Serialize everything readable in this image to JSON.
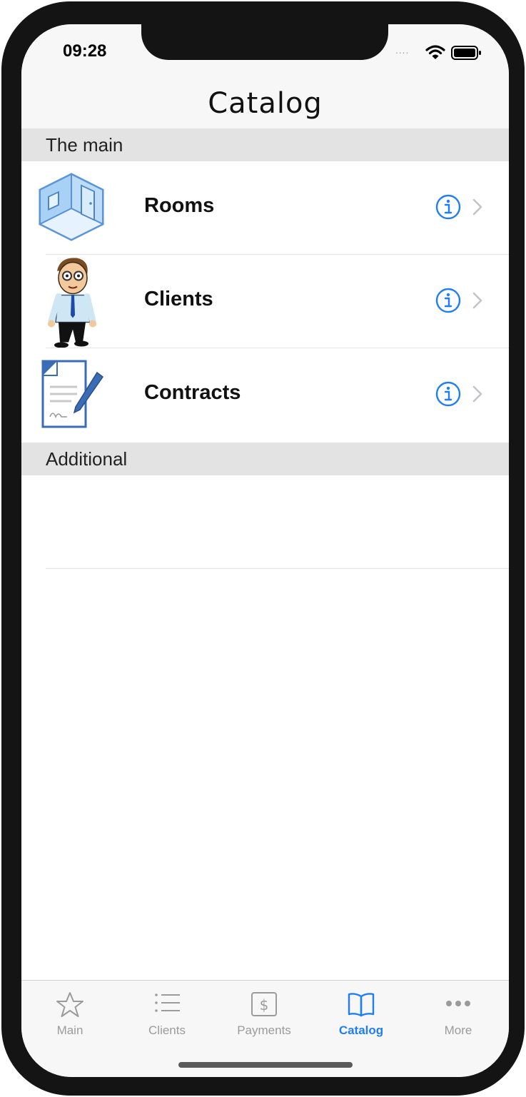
{
  "status_bar": {
    "time": "09:28",
    "signal": "....",
    "wifi_icon": "wifi-icon",
    "battery_icon": "battery-icon"
  },
  "nav": {
    "title": "Catalog"
  },
  "sections": [
    {
      "header": "The main",
      "rows": [
        {
          "label": "Rooms",
          "icon": "room-icon"
        },
        {
          "label": "Clients",
          "icon": "client-person-icon"
        },
        {
          "label": "Contracts",
          "icon": "contract-document-icon"
        }
      ]
    },
    {
      "header": "Additional",
      "rows": []
    }
  ],
  "accessory_icons": {
    "info": "info-circle-icon",
    "chevron": "chevron-right-icon"
  },
  "tabs": [
    {
      "label": "Main",
      "icon": "star-icon",
      "active": false
    },
    {
      "label": "Clients",
      "icon": "list-icon",
      "active": false
    },
    {
      "label": "Payments",
      "icon": "dollar-square-icon",
      "active": false
    },
    {
      "label": "Catalog",
      "icon": "book-icon",
      "active": true
    },
    {
      "label": "More",
      "icon": "more-dots-icon",
      "active": false
    }
  ],
  "colors": {
    "accent": "#1f7ef4",
    "section_bg": "#e3e3e3",
    "bar_bg": "#f7f7f7",
    "inactive": "#9b9b9b"
  }
}
